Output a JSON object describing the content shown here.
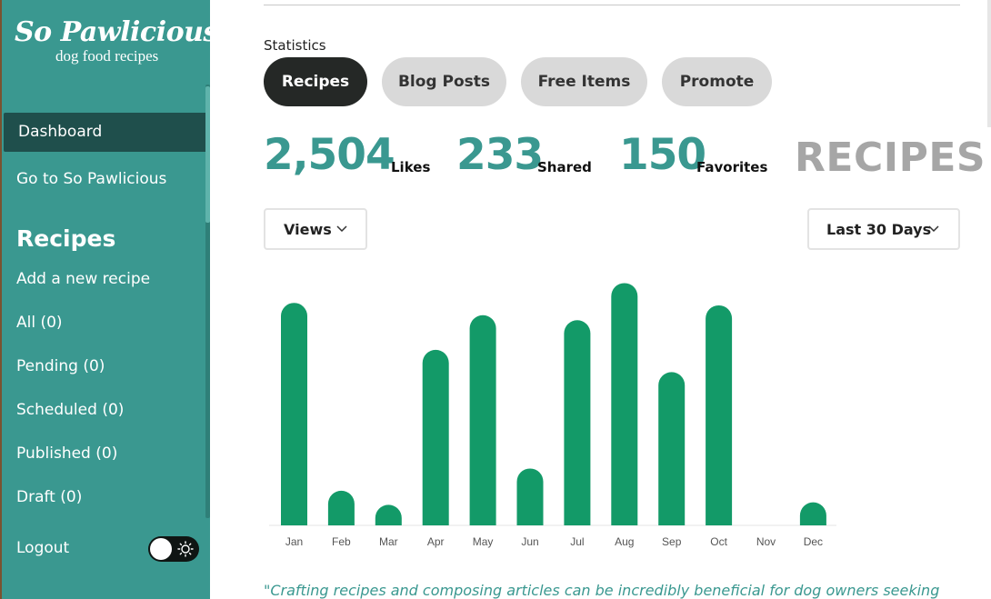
{
  "sidebar": {
    "logo_title": "So Pawlicious",
    "logo_subtitle": "dog food recipes",
    "nav": [
      {
        "label": "Dashboard"
      },
      {
        "label": "Go to So Pawlicious"
      }
    ],
    "section_heading": "Recipes",
    "recipe_items": [
      {
        "label": "Add a new recipe"
      },
      {
        "label": "All (0)"
      },
      {
        "label": "Pending (0)"
      },
      {
        "label": "Scheduled (0)"
      },
      {
        "label": "Published (0)"
      },
      {
        "label": "Draft (0)"
      }
    ],
    "logout_label": "Logout",
    "theme_toggle_icon": "sun-icon",
    "colors": {
      "background": "#3a9890",
      "active_item": "#1f4f4c"
    }
  },
  "main": {
    "statistics_label": "Statistics",
    "tabs": [
      {
        "label": "Recipes",
        "active": true
      },
      {
        "label": "Blog Posts",
        "active": false
      },
      {
        "label": "Free Items",
        "active": false
      },
      {
        "label": "Promote",
        "active": false
      }
    ],
    "stats": [
      {
        "value": "2,504",
        "label": "Likes"
      },
      {
        "value": "233",
        "label": "Shared"
      },
      {
        "value": "150",
        "label": "Favorites"
      }
    ],
    "section_word": "RECIPES",
    "metric_dropdown": "Views",
    "range_dropdown": "Last 30 Days",
    "quote": "\"Crafting recipes and composing articles can be incredibly beneficial for dog owners seeking",
    "colors": {
      "accent": "#3a9890",
      "bar": "#139a68",
      "muted": "#a6a6a6"
    }
  },
  "chart_data": {
    "type": "bar",
    "categories": [
      "Jan",
      "Feb",
      "Mar",
      "Apr",
      "May",
      "Jun",
      "Jul",
      "Aug",
      "Sep",
      "Oct",
      "Nov",
      "Dec"
    ],
    "values": [
      90,
      14,
      6,
      71,
      85,
      23,
      83,
      98,
      62,
      89,
      0,
      8
    ],
    "ylim": [
      0,
      100
    ],
    "grid": false,
    "xlabel": "",
    "ylabel": ""
  }
}
